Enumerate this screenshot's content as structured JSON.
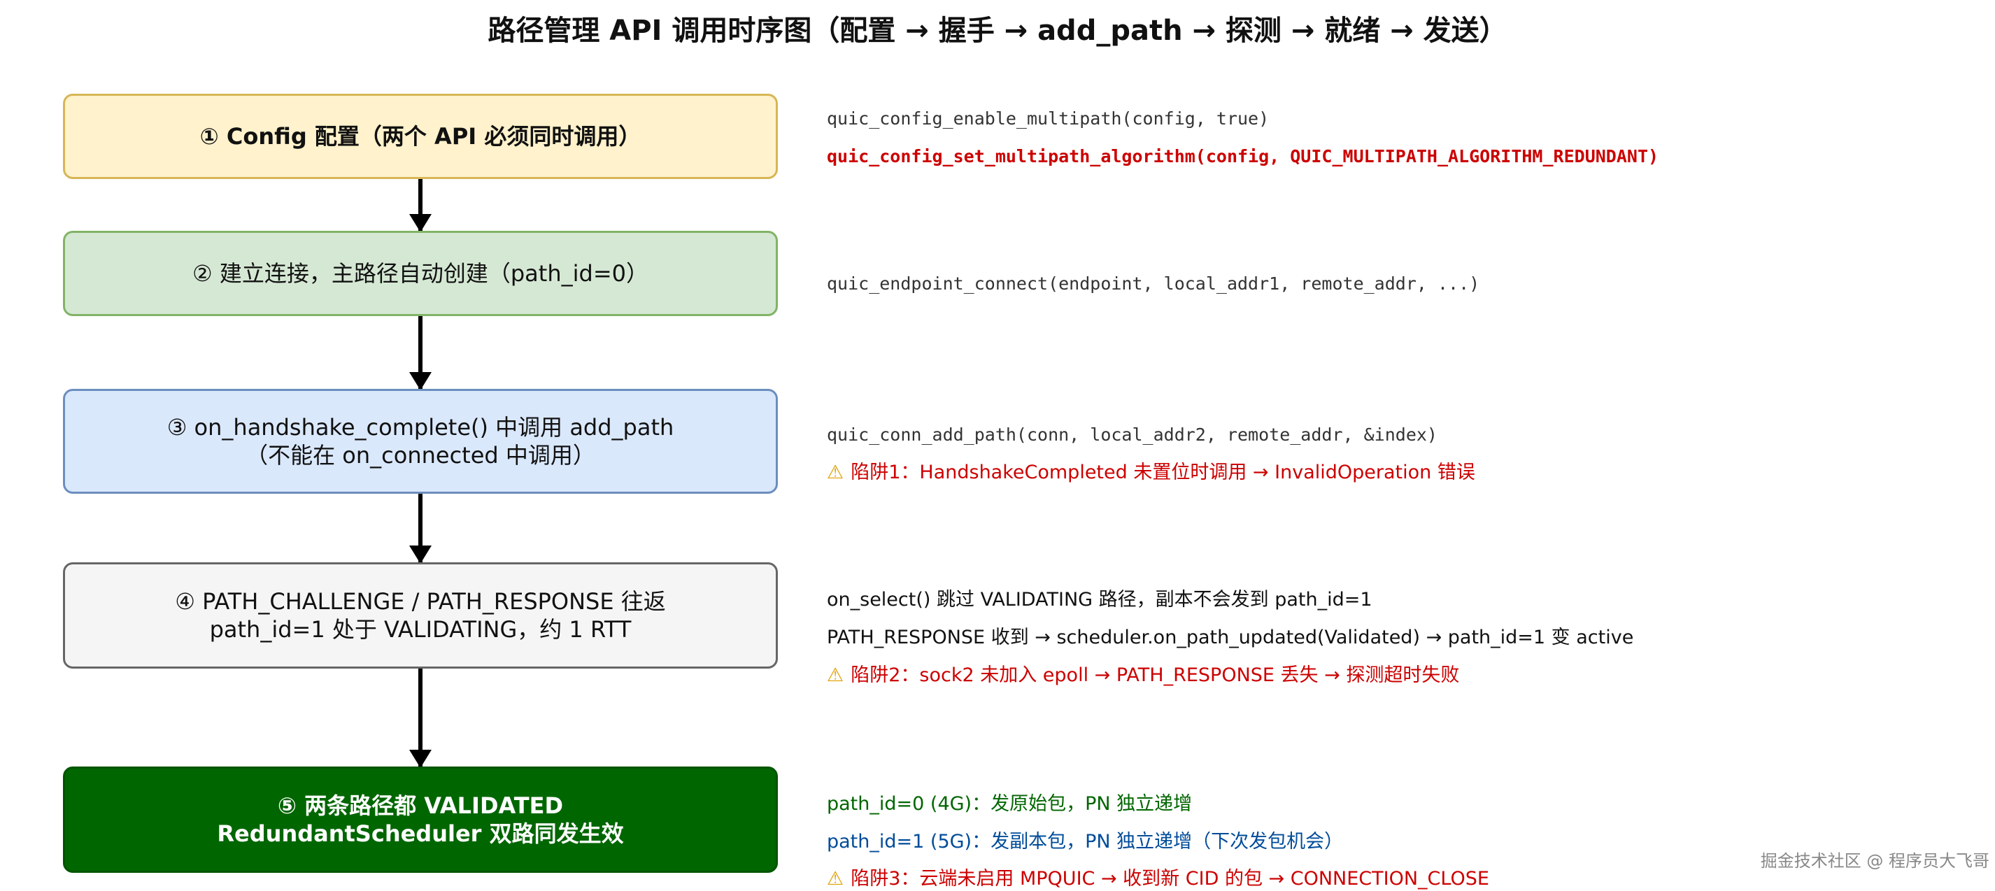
{
  "title": "路径管理 API 调用时序图（配置 → 握手 → add_path → 探测 → 就绪 → 发送）",
  "steps": [
    {
      "lines": [
        "① Config 配置（两个 API 必须同时调用）"
      ]
    },
    {
      "lines": [
        "② 建立连接，主路径自动创建（path_id=0）"
      ]
    },
    {
      "lines": [
        "③ on_handshake_complete() 中调用 add_path",
        "（不能在 on_connected 中调用）"
      ]
    },
    {
      "lines": [
        "④ PATH_CHALLENGE / PATH_RESPONSE 往返",
        "path_id=1 处于 VALIDATING，约 1 RTT"
      ]
    },
    {
      "lines": [
        "⑤ 两条路径都 VALIDATED",
        "RedundantScheduler 双路同发生效"
      ]
    }
  ],
  "notes": {
    "n1": "quic_config_enable_multipath(config, true)",
    "n2": "quic_config_set_multipath_algorithm(config, QUIC_MULTIPATH_ALGORITHM_REDUNDANT)",
    "n3": "quic_endpoint_connect(endpoint, local_addr1, remote_addr, ...)",
    "n4": "quic_conn_add_path(conn, local_addr2, remote_addr, &index)",
    "n5": "陷阱1：HandshakeCompleted 未置位时调用 → InvalidOperation 错误",
    "n6": "on_select() 跳过 VALIDATING 路径，副本不会发到 path_id=1",
    "n7": "PATH_RESPONSE 收到 → scheduler.on_path_updated(Validated) → path_id=1 变 active",
    "n8": "陷阱2：sock2 未加入 epoll → PATH_RESPONSE 丢失 → 探测超时失败",
    "n9": "path_id=0 (4G)：发原始包，PN 独立递增",
    "n10": "path_id=1 (5G)：发副本包，PN 独立递增（下次发包机会）",
    "n11": "陷阱3：云端未启用 MPQUIC → 收到新 CID 的包 → CONNECTION_CLOSE"
  },
  "warning_icon": "warning-icon",
  "watermark": "掘金技术社区 @ 程序员大飞哥",
  "colors": {
    "step1_fill": "#fff2cc",
    "step2_fill": "#d5e8d4",
    "step3_fill": "#dae8fc",
    "step4_fill": "#f5f5f5",
    "step5_fill": "#006600",
    "warning_text": "#cc0000",
    "path0_text": "#006600",
    "path1_text": "#004c99"
  }
}
